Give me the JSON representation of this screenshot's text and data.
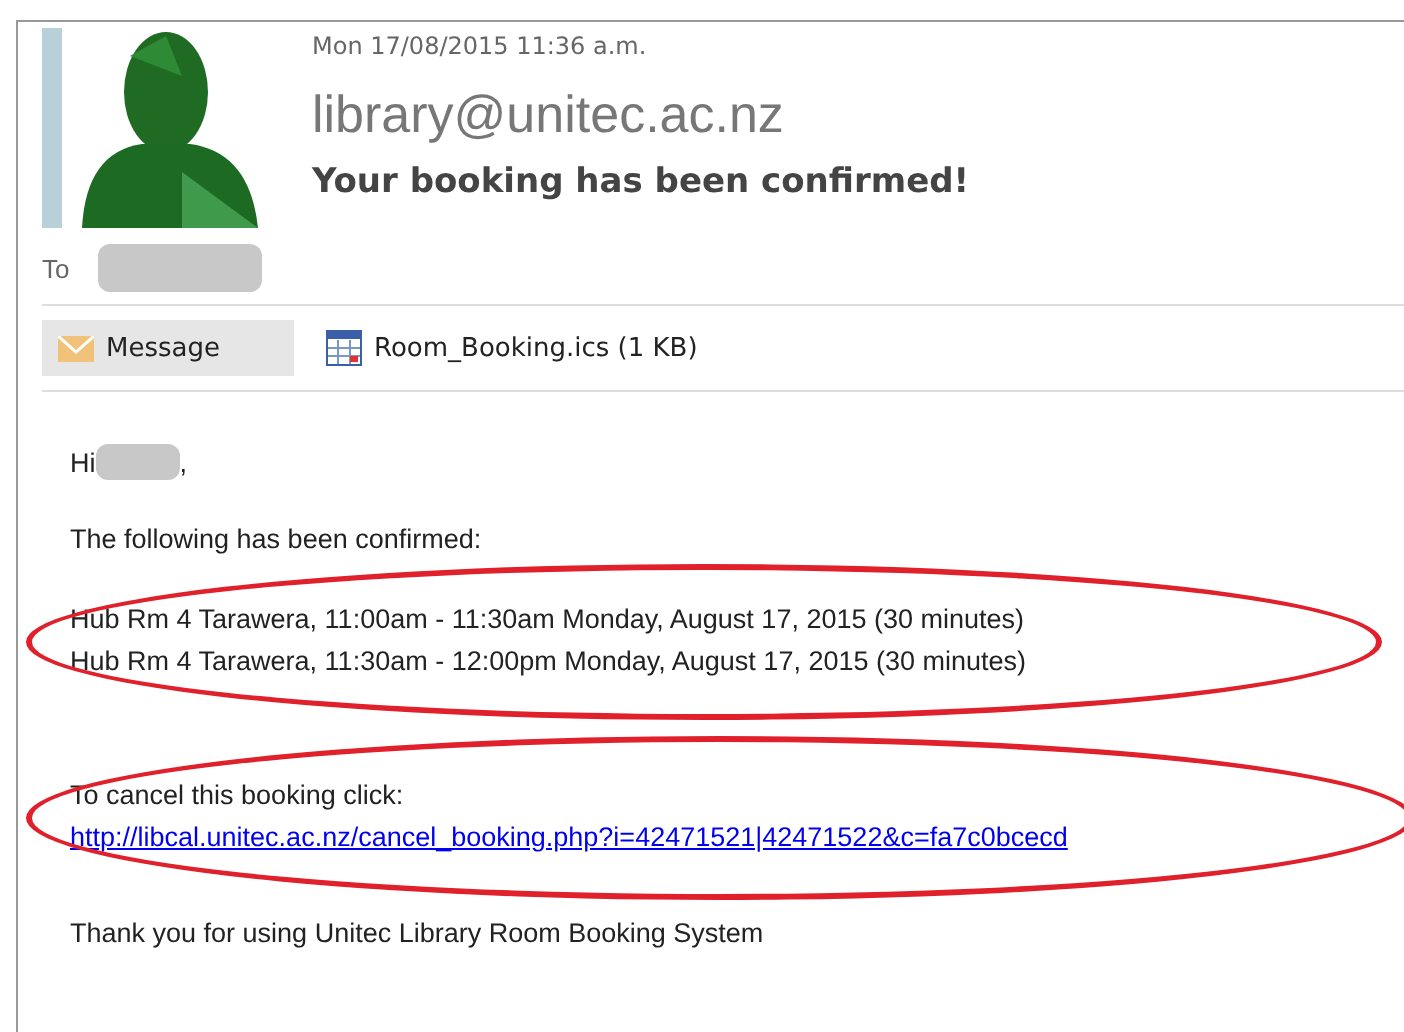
{
  "header": {
    "date": "Mon 17/08/2015 11:36 a.m.",
    "sender": "library@unitec.ac.nz",
    "subject": "Your booking has been confirmed!",
    "to_label": "To"
  },
  "tabs": [
    {
      "label": "Message",
      "kind": "message",
      "selected": true
    },
    {
      "label": "Room_Booking.ics (1 KB)",
      "kind": "calendar",
      "selected": false
    }
  ],
  "body": {
    "greeting": "Hi",
    "greeting_end": ",",
    "intro": "The following has been confirmed:",
    "bookings": [
      "Hub Rm 4 Tarawera, 11:00am - 11:30am Monday, August 17, 2015 (30 minutes)",
      "Hub Rm 4 Tarawera, 11:30am - 12:00pm Monday, August 17, 2015 (30 minutes)"
    ],
    "cancel_text": "To cancel this booking click:",
    "cancel_link": "http://libcal.unitec.ac.nz/cancel_booking.php?i=42471521|42471522&c=fa7c0bcecd",
    "closing": "Thank you for using Unitec Library Room Booking System"
  }
}
